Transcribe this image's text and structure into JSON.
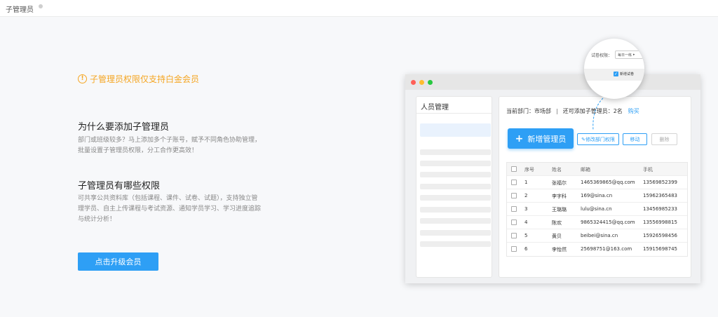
{
  "topbar": {
    "title": "子管理员"
  },
  "notice": {
    "icon": "warning-circle-icon",
    "text": "子管理员权限仅支持白金会员"
  },
  "why": {
    "heading": "为什么要添加子管理员",
    "desc": "部门或班级较多？马上添加多个子账号，赋予不同角色协助管理，批量设置子管理员权限，分工合作更高效！"
  },
  "perms": {
    "heading": "子管理员有哪些权限",
    "desc": "可共享公共资料库（包括课程、课件、试卷、试题），支持独立管理学员、自主上传课程与考试资源、通知学员学习、学习进度追踪与统计分析！"
  },
  "upgrade_button": "点击升级会员",
  "preview": {
    "window_dots": [
      "#ff5f57",
      "#febc2e",
      "#28c840"
    ],
    "left_panel_title": "人员管理",
    "dept_label": "当前部门：市场部",
    "separator": "|",
    "quota_label": "还可添加子管理员：2名",
    "buy_link": "购买",
    "add_admin_button": "新增管理员",
    "edit_perm_button": "修改部门权限",
    "move_button": "移动",
    "delete_button": "删除",
    "table": {
      "headers": [
        "序号",
        "姓名",
        "邮箱",
        "手机"
      ],
      "rows": [
        [
          "1",
          "张福尔",
          "1465369865@qq.com",
          "13569852399"
        ],
        [
          "2",
          "李字科",
          "169@sina.cn",
          "15962365483"
        ],
        [
          "3",
          "王璐璐",
          "lulu@sina.cn",
          "13456985233"
        ],
        [
          "4",
          "陈欢",
          "9865324415@qq.com",
          "13556998815"
        ],
        [
          "5",
          "黄贝",
          "beibei@sina.cn",
          "15926598456"
        ],
        [
          "6",
          "李怡然",
          "25698751@163.com",
          "15915698745"
        ]
      ]
    },
    "magnifier": {
      "perm_label": "试卷权限：",
      "select_value": "每日一练",
      "checkbox_label": "新增试卷"
    }
  },
  "colors": {
    "accent": "#2e9ff5",
    "warning": "#f5a623"
  }
}
